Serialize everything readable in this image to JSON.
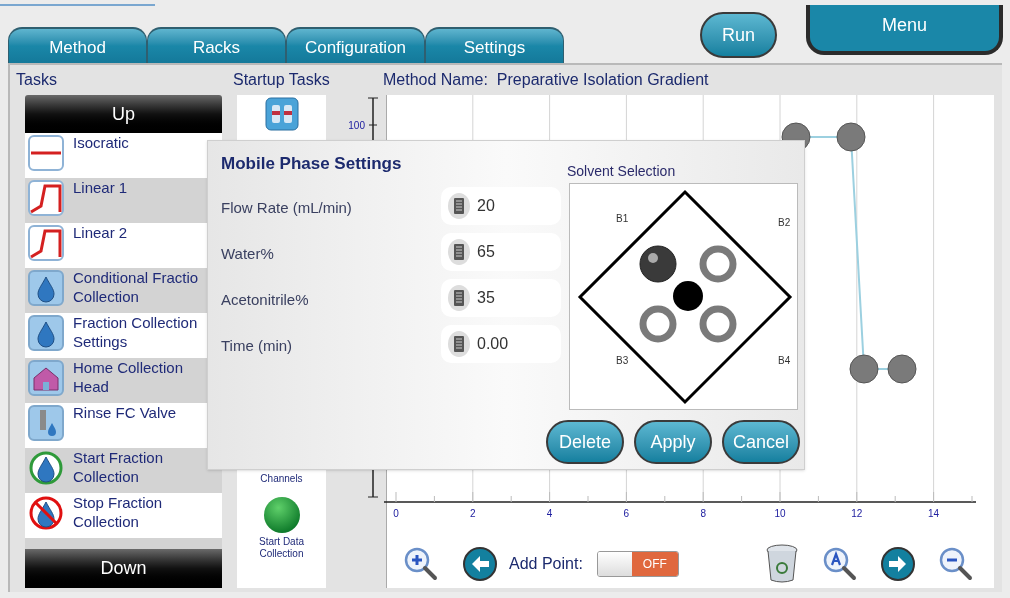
{
  "tabs": [
    {
      "label": "Method"
    },
    {
      "label": "Racks"
    },
    {
      "label": "Configuration"
    },
    {
      "label": "Settings"
    }
  ],
  "run_button": "Run",
  "menu_button": "Menu",
  "tasks": {
    "title": "Tasks",
    "up": "Up",
    "down": "Down",
    "items": [
      {
        "label": "Isocratic",
        "kind": "isocratic"
      },
      {
        "label": "Linear 1",
        "kind": "linear"
      },
      {
        "label": "Linear 2",
        "kind": "linear"
      },
      {
        "label": "Conditional Fractio Collection",
        "kind": "conditional"
      },
      {
        "label": "Fraction Collection Settings",
        "kind": "drop"
      },
      {
        "label": "Home Collection Head",
        "kind": "home"
      },
      {
        "label": "Rinse FC Valve",
        "kind": "rinse"
      },
      {
        "label": "Start Fraction Collection",
        "kind": "start"
      },
      {
        "label": "Stop Fraction Collection",
        "kind": "stop"
      }
    ]
  },
  "startup_tasks": {
    "title": "Startup Tasks",
    "items": [
      {
        "label": "Channels",
        "kind": "text"
      },
      {
        "label": "Start Data Collection",
        "kind": "green"
      }
    ]
  },
  "method": {
    "label": "Method Name:",
    "name": "Preparative Isolation Gradient"
  },
  "chart": {
    "y_tick": "100",
    "x_ticks": [
      "0",
      "2",
      "4",
      "6",
      "8",
      "10",
      "12",
      "14"
    ]
  },
  "toolbar": {
    "add_point_label": "Add Point:",
    "toggle": {
      "on": false,
      "text": "OFF"
    }
  },
  "dialog": {
    "title": "Mobile Phase Settings",
    "fields": [
      {
        "label": "Flow Rate (mL/min)",
        "value": "20"
      },
      {
        "label": "Water%",
        "value": "65"
      },
      {
        "label": "Acetonitrile%",
        "value": "35"
      },
      {
        "label": "Time (min)",
        "value": "0.00"
      }
    ],
    "solvent_title": "Solvent Selection",
    "solvents": [
      {
        "label": "B1",
        "selected": true
      },
      {
        "label": "B2",
        "selected": false
      },
      {
        "label": "B3",
        "selected": false
      },
      {
        "label": "B4",
        "selected": false
      }
    ],
    "buttons": [
      "Delete",
      "Apply",
      "Cancel"
    ]
  }
}
